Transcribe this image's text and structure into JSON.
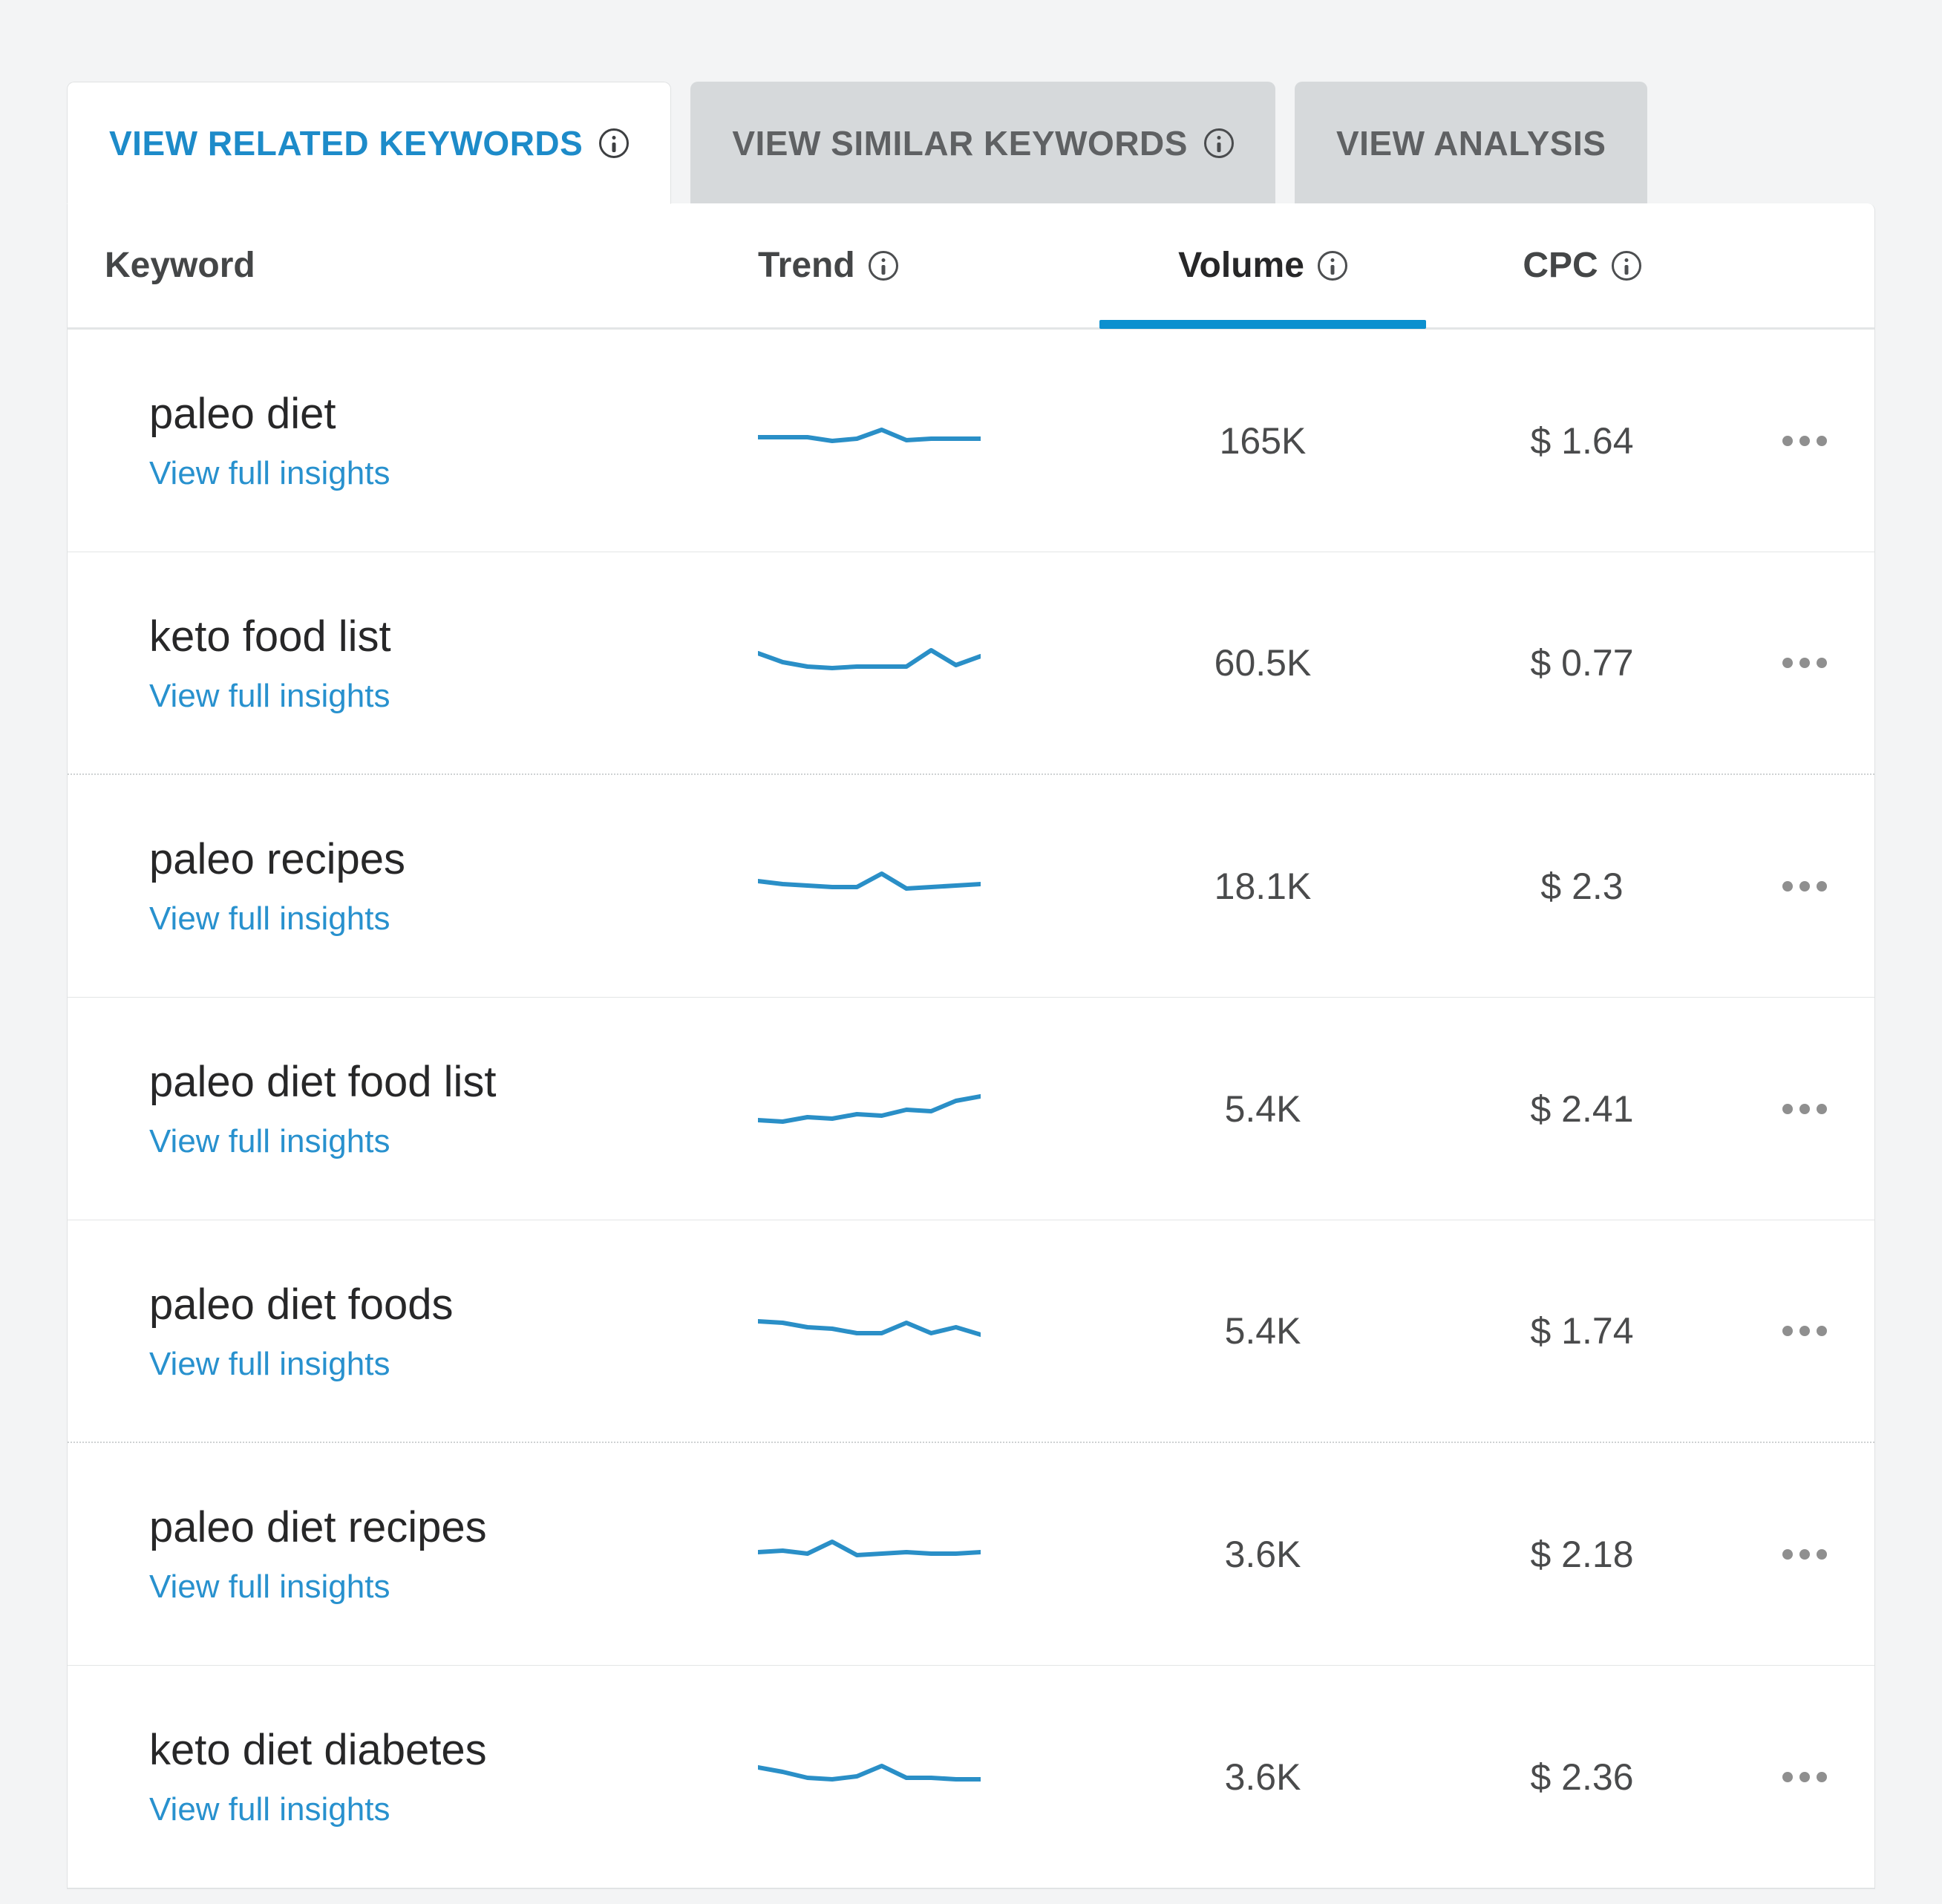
{
  "tabs": {
    "related": {
      "label": "VIEW RELATED KEYWORDS",
      "active": true
    },
    "similar": {
      "label": "VIEW SIMILAR KEYWORDS",
      "active": false
    },
    "analysis": {
      "label": "VIEW ANALYSIS",
      "active": false
    }
  },
  "columns": {
    "keyword": "Keyword",
    "trend": "Trend",
    "volume": "Volume",
    "cpc": "CPC",
    "sorted": "volume"
  },
  "insights_link": "View full insights",
  "rows": [
    {
      "keyword": "paleo diet",
      "volume": "165K",
      "cpc": "$ 1.64",
      "trend": [
        20,
        20,
        20,
        25,
        22,
        10,
        24,
        22,
        22,
        22
      ]
    },
    {
      "keyword": "keto food list",
      "volume": "60.5K",
      "cpc": "$ 0.77",
      "trend": [
        12,
        24,
        30,
        32,
        30,
        30,
        30,
        8,
        28,
        16
      ]
    },
    {
      "keyword": "paleo recipes",
      "volume": "18.1K",
      "cpc": "$ 2.3",
      "trend": [
        18,
        22,
        24,
        26,
        26,
        8,
        28,
        26,
        24,
        22
      ]
    },
    {
      "keyword": "paleo diet food list",
      "volume": "5.4K",
      "cpc": "$ 2.41",
      "trend": [
        40,
        42,
        36,
        38,
        32,
        34,
        26,
        28,
        14,
        8
      ]
    },
    {
      "keyword": "paleo diet foods",
      "volume": "5.4K",
      "cpc": "$ 1.74",
      "trend": [
        12,
        14,
        20,
        22,
        28,
        28,
        14,
        28,
        20,
        30
      ]
    },
    {
      "keyword": "paleo diet recipes",
      "volume": "3.6K",
      "cpc": "$ 2.18",
      "trend": [
        22,
        20,
        24,
        8,
        26,
        24,
        22,
        24,
        24,
        22
      ]
    },
    {
      "keyword": "keto diet diabetes",
      "volume": "3.6K",
      "cpc": "$ 2.36",
      "trend": [
        12,
        18,
        26,
        28,
        24,
        10,
        26,
        26,
        28,
        28
      ]
    }
  ],
  "chart_data": {
    "type": "table",
    "title": "Related Keywords",
    "columns": [
      "Keyword",
      "Volume",
      "CPC"
    ],
    "series": [
      {
        "name": "paleo diet",
        "values": [
          165000,
          1.64
        ]
      },
      {
        "name": "keto food list",
        "values": [
          60500,
          0.77
        ]
      },
      {
        "name": "paleo recipes",
        "values": [
          18100,
          2.3
        ]
      },
      {
        "name": "paleo diet food list",
        "values": [
          5400,
          2.41
        ]
      },
      {
        "name": "paleo diet foods",
        "values": [
          5400,
          1.74
        ]
      },
      {
        "name": "paleo diet recipes",
        "values": [
          3600,
          2.18
        ]
      },
      {
        "name": "keto diet diabetes",
        "values": [
          3600,
          2.36
        ]
      }
    ]
  },
  "colors": {
    "accent": "#1d8bc9",
    "link": "#2891ce"
  }
}
